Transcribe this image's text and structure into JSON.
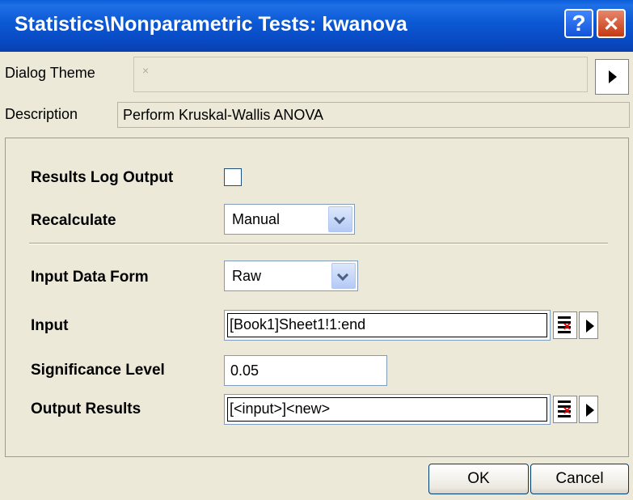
{
  "window": {
    "title": "Statistics\\Nonparametric Tests: kwanova",
    "help_glyph": "?",
    "close_glyph": "✕"
  },
  "theme": {
    "label": "Dialog Theme",
    "value": "×"
  },
  "description": {
    "label": "Description",
    "value": "Perform Kruskal-Wallis ANOVA"
  },
  "form": {
    "results_log_output": {
      "label": "Results Log Output",
      "checked": false
    },
    "recalculate": {
      "label": "Recalculate",
      "value": "Manual"
    },
    "input_data_form": {
      "label": "Input Data Form",
      "value": "Raw"
    },
    "input": {
      "label": "Input",
      "value": "[Book1]Sheet1!1:end"
    },
    "significance_level": {
      "label": "Significance Level",
      "value": "0.05"
    },
    "output_results": {
      "label": "Output Results",
      "value": "[<input>]<new>"
    }
  },
  "buttons": {
    "ok": "OK",
    "cancel": "Cancel"
  },
  "colors": {
    "titlebar": "#0a5fd8",
    "dialog_bg": "#ece9d8",
    "close": "#c33a12"
  }
}
